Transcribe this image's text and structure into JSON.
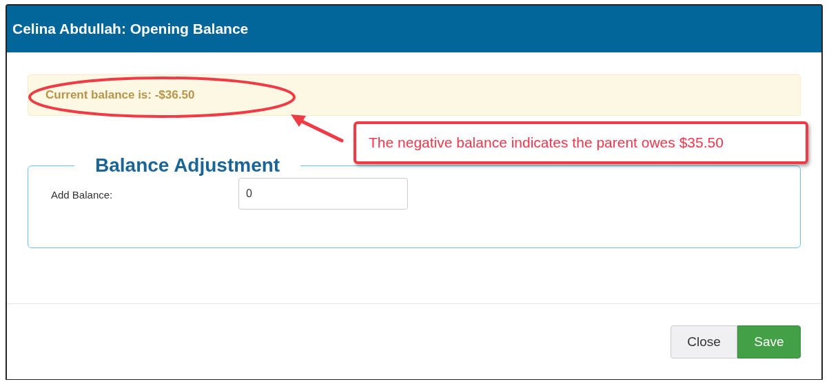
{
  "dialog": {
    "title": "Celina Abdullah: Opening Balance"
  },
  "alert": {
    "text": "Current balance is: -$36.50"
  },
  "section": {
    "heading": "Balance Adjustment",
    "fields": [
      {
        "label": "Add Balance:",
        "value": "0"
      }
    ]
  },
  "buttons": [
    {
      "label": "Close",
      "kind": "default"
    },
    {
      "label": "Save",
      "kind": "primary"
    }
  ],
  "annotation": {
    "text": "The negative balance indicates the parent owes $35.50"
  }
}
